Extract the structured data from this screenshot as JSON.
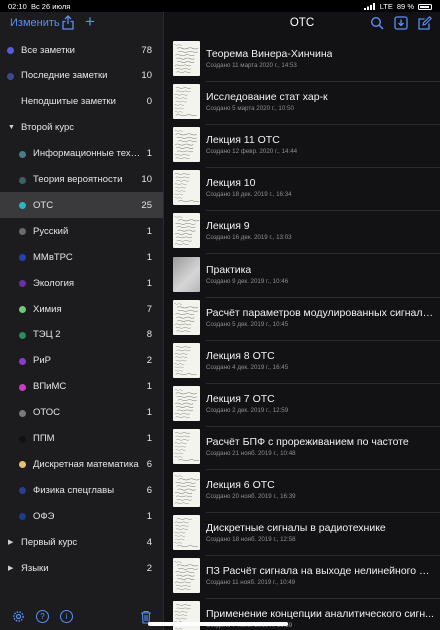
{
  "status": {
    "time": "02:10",
    "date": "Вс 26 июля",
    "network": "LTE",
    "battery": "89 %"
  },
  "sidebar": {
    "edit_label": "Изменить",
    "top": [
      {
        "label": "Все заметки",
        "count": "78",
        "color": "#5b5bd6"
      },
      {
        "label": "Последние заметки",
        "count": "10",
        "color": "#3b4a8c"
      },
      {
        "label": "Неподшитые заметки",
        "count": "0",
        "color": "#1c1c1e"
      }
    ],
    "group_open": {
      "label": "Второй курс"
    },
    "folders": [
      {
        "label": "Информационные техно...",
        "count": "1",
        "color": "#4a7a8a"
      },
      {
        "label": "Теория вероятности",
        "count": "10",
        "color": "#3e5f66"
      },
      {
        "label": "ОТС",
        "count": "25",
        "color": "#2bb5c8",
        "selected": true
      },
      {
        "label": "Русский",
        "count": "1",
        "color": "#6a6a6a"
      },
      {
        "label": "ММвТРС",
        "count": "1",
        "color": "#2b3eb0"
      },
      {
        "label": "Экология",
        "count": "1",
        "color": "#6a2ea8"
      },
      {
        "label": "Химия",
        "count": "7",
        "color": "#6fc87a"
      },
      {
        "label": "ТЭЦ 2",
        "count": "8",
        "color": "#2a8c5a"
      },
      {
        "label": "РиР",
        "count": "2",
        "color": "#8a3ec8"
      },
      {
        "label": "ВПиМС",
        "count": "1",
        "color": "#c83ec0"
      },
      {
        "label": "ОТОС",
        "count": "1",
        "color": "#7a7a7c"
      },
      {
        "label": "ППМ",
        "count": "1",
        "color": "#111111"
      },
      {
        "label": "Дискретная математика",
        "count": "6",
        "color": "#e6c36a"
      },
      {
        "label": "Физика спецглавы",
        "count": "6",
        "color": "#2a3e8c"
      },
      {
        "label": "ОФЭ",
        "count": "1",
        "color": "#1e3a8c"
      }
    ],
    "groups_closed": [
      {
        "label": "Первый курс",
        "count": "4"
      },
      {
        "label": "Языки",
        "count": "2"
      }
    ],
    "icons": [
      "gear-icon",
      "help-icon",
      "info-icon",
      "trash-icon"
    ]
  },
  "detail": {
    "title": "ОТС",
    "notes": [
      {
        "title": "Теорема Винера-Хинчина",
        "date": "Создано 11 марта 2020 г., 14:53"
      },
      {
        "title": "Исследование стат хар-к",
        "date": "Создано 5 марта 2020 г., 10:50"
      },
      {
        "title": "Лекция 11 ОТС",
        "date": "Создано 12 февр. 2020 г., 14:44"
      },
      {
        "title": "Лекция 10",
        "date": "Создано 18 дек. 2019 г., 16:34"
      },
      {
        "title": "Лекция 9",
        "date": "Создано 16 дек. 2019 г., 13:03"
      },
      {
        "title": "Практика",
        "date": "Создано 9 дек. 2019 г., 10:46",
        "photo": true
      },
      {
        "title": "Расчёт параметров модулированных сигналов",
        "date": "Создано 5 дек. 2019 г., 10:45"
      },
      {
        "title": "Лекция 8 ОТС",
        "date": "Создано 4 дек. 2019 г., 16:45"
      },
      {
        "title": "Лекция 7 ОТС",
        "date": "Создано 2 дек. 2019 г., 12:59"
      },
      {
        "title": "Расчёт БПФ с прореживанием по частоте",
        "date": "Создано 21 нояб. 2019 г., 10:48"
      },
      {
        "title": "Лекция 6 ОТС",
        "date": "Создано 20 нояб. 2019 г., 16:39"
      },
      {
        "title": "Дискретные сигналы в радиотехнике",
        "date": "Создано 18 нояб. 2019 г., 12:58"
      },
      {
        "title": "ПЗ Расчёт сигнала на выходе нелинейного пр...",
        "date": "Создано 11 нояб. 2019 г., 10:49"
      },
      {
        "title": "Применение концепции аналитического сигн...",
        "date": "Создано 7 нояб. 2019 г., 16:59"
      }
    ]
  }
}
